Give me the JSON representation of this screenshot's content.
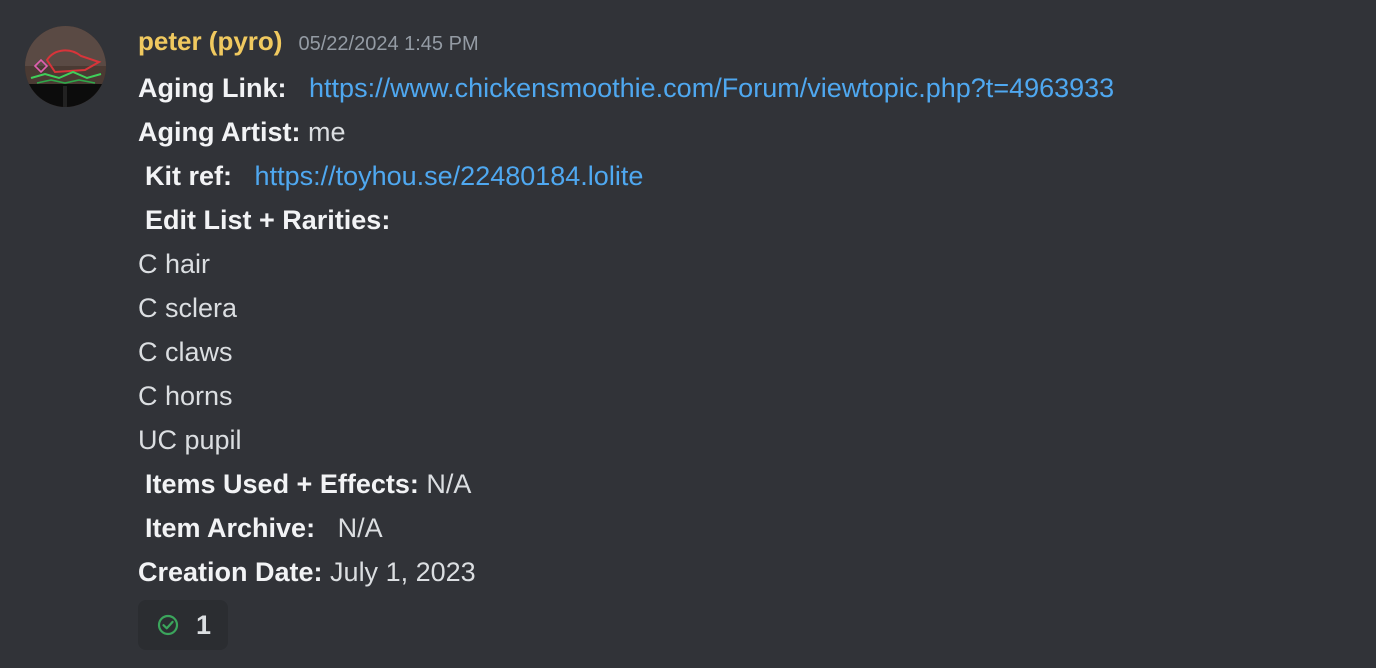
{
  "author": {
    "name": "peter (pyro)",
    "timestamp": "05/22/2024 1:45 PM",
    "name_color": "#f0c95f"
  },
  "message": {
    "aging_link_label": "Aging Link:",
    "aging_link_url": "https://www.chickensmoothie.com/Forum/viewtopic.php?t=4963933",
    "aging_artist_label": "Aging Artist:",
    "aging_artist_value": "me",
    "kit_ref_label": "Kit ref:",
    "kit_ref_url": "https://toyhou.se/22480184.lolite",
    "edit_list_label": "Edit List + Rarities:",
    "edits": [
      "C hair",
      "C sclera",
      "C claws",
      "C horns",
      "UC pupil"
    ],
    "items_used_label": "Items Used + Effects:",
    "items_used_value": "N/A",
    "item_archive_label": "Item Archive:",
    "item_archive_value": "N/A",
    "creation_date_label": "Creation Date:",
    "creation_date_value": "July 1, 2023",
    "link_color": "#4fa8f0"
  },
  "reaction": {
    "icon": "check-circle-icon",
    "count": "1",
    "icon_color": "#3ba55c"
  }
}
